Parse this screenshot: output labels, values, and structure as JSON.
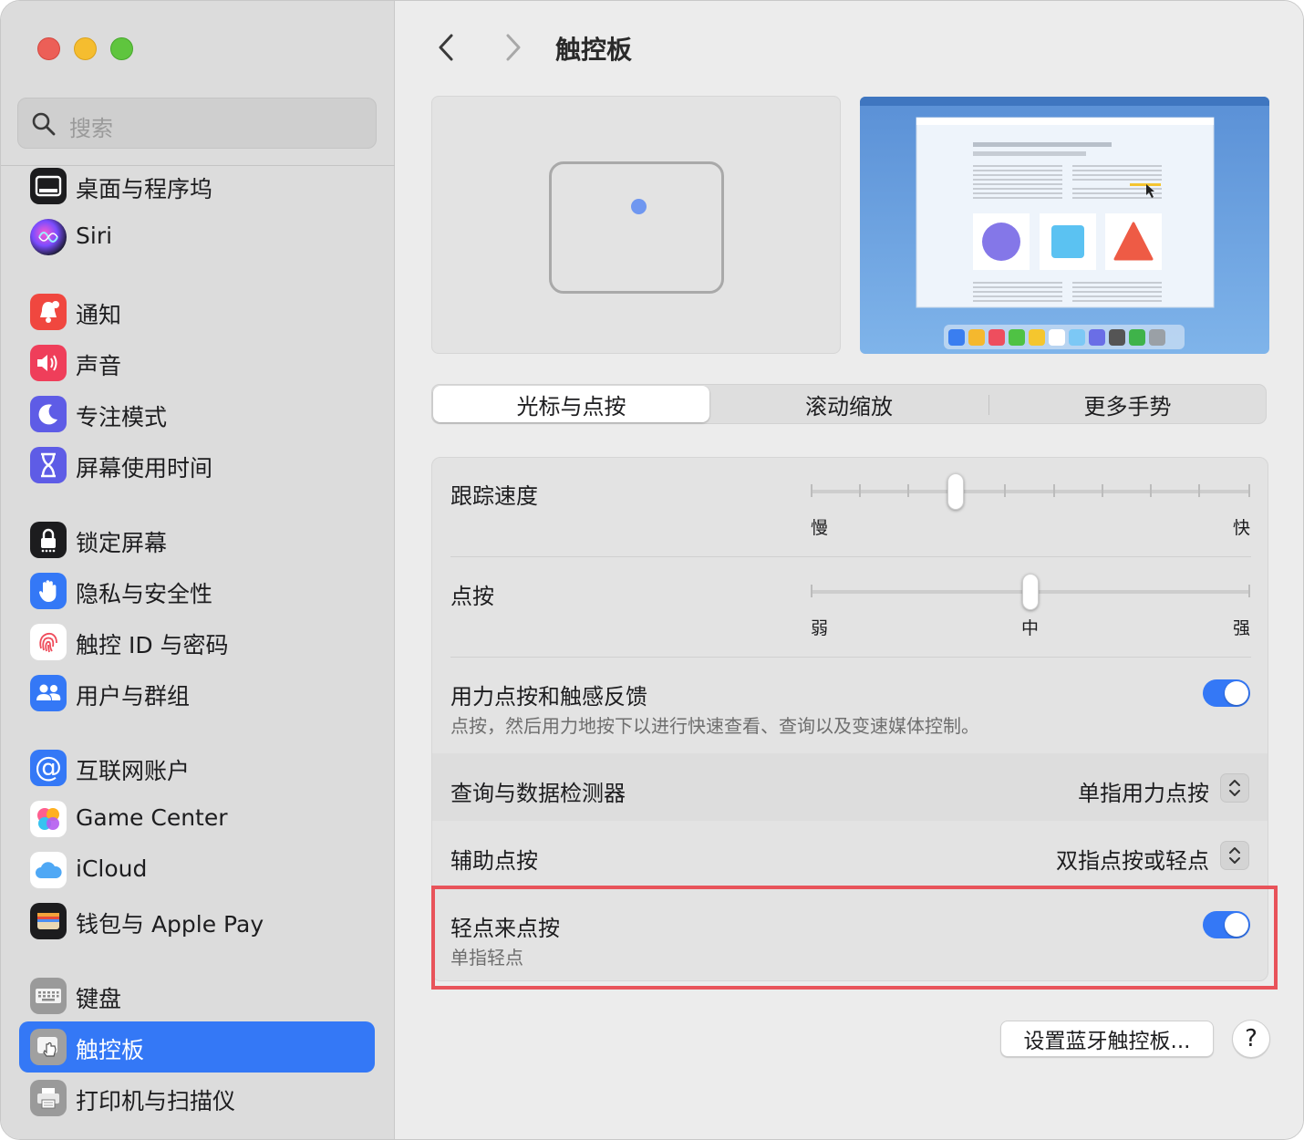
{
  "sidebar": {
    "search_placeholder": "搜索",
    "items": [
      {
        "label": "桌面与程序坞",
        "icon": "dock-icon"
      },
      {
        "label": "Siri",
        "icon": "siri-icon"
      },
      {
        "label": "通知",
        "icon": "bell-icon"
      },
      {
        "label": "声音",
        "icon": "speaker-icon"
      },
      {
        "label": "专注模式",
        "icon": "moon-icon"
      },
      {
        "label": "屏幕使用时间",
        "icon": "hourglass-icon"
      },
      {
        "label": "锁定屏幕",
        "icon": "lock-icon"
      },
      {
        "label": "隐私与安全性",
        "icon": "hand-icon"
      },
      {
        "label": "触控 ID 与密码",
        "icon": "fingerprint-icon"
      },
      {
        "label": "用户与群组",
        "icon": "users-icon"
      },
      {
        "label": "互联网账户",
        "icon": "at-icon"
      },
      {
        "label": "Game Center",
        "icon": "game-center-icon"
      },
      {
        "label": "iCloud",
        "icon": "cloud-icon"
      },
      {
        "label": "钱包与 Apple Pay",
        "icon": "wallet-icon"
      },
      {
        "label": "键盘",
        "icon": "keyboard-icon"
      },
      {
        "label": "触控板",
        "icon": "trackpad-icon",
        "selected": true
      },
      {
        "label": "打印机与扫描仪",
        "icon": "printer-icon"
      }
    ]
  },
  "header": {
    "title": "触控板"
  },
  "tabs": [
    {
      "label": "光标与点按",
      "active": true
    },
    {
      "label": "滚动缩放",
      "active": false
    },
    {
      "label": "更多手势",
      "active": false
    }
  ],
  "settings": {
    "tracking_speed": {
      "title": "跟踪速度",
      "min_label": "慢",
      "max_label": "快",
      "value": 0.33
    },
    "click": {
      "title": "点按",
      "min_label": "弱",
      "mid_label": "中",
      "max_label": "强",
      "value": 0.5
    },
    "force_click": {
      "title": "用力点按和触感反馈",
      "subtitle": "点按，然后用力地按下以进行快速查看、查询以及变速媒体控制。",
      "on": true
    },
    "lookup": {
      "title": "查询与数据检测器",
      "value": "单指用力点按"
    },
    "secondary_click": {
      "title": "辅助点按",
      "value": "双指点按或轻点"
    },
    "tap_to_click": {
      "title": "轻点来点按",
      "subtitle": "单指轻点",
      "on": true
    }
  },
  "footer": {
    "bluetooth_button": "设置蓝牙触控板...",
    "help_button": "?"
  },
  "colors": {
    "accent": "#3478f6",
    "highlight": "#e8535a"
  }
}
